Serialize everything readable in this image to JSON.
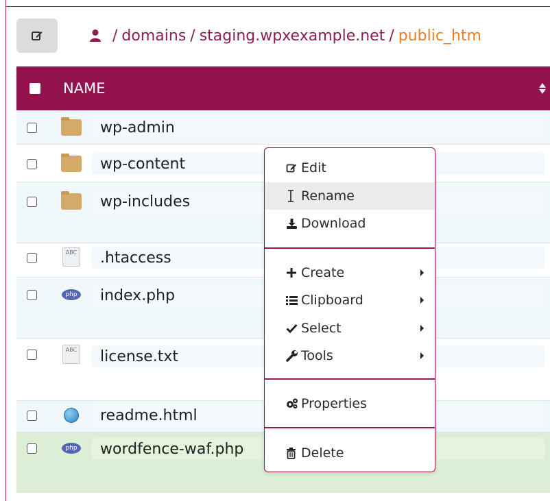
{
  "breadcrumb": {
    "items": [
      "domains",
      "staging.wpxexample.net"
    ],
    "current": "public_htm",
    "separator": "/"
  },
  "table": {
    "header_name": "NAME",
    "rows": [
      {
        "name": "wp-admin",
        "type": "folder"
      },
      {
        "name": "wp-content",
        "type": "folder"
      },
      {
        "name": "wp-includes",
        "type": "folder"
      },
      {
        "name": ".htaccess",
        "type": "text"
      },
      {
        "name": "index.php",
        "type": "php"
      },
      {
        "name": "license.txt",
        "type": "text"
      },
      {
        "name": "readme.html",
        "type": "html"
      },
      {
        "name": "wordfence-waf.php",
        "type": "php",
        "selected": true
      }
    ]
  },
  "icons": {
    "text_label": "ABC",
    "php_label": "php"
  },
  "context_menu": {
    "items": [
      {
        "label": "Edit",
        "icon": "edit-icon"
      },
      {
        "label": "Rename",
        "icon": "text-cursor-icon"
      },
      {
        "label": "Download",
        "icon": "download-icon"
      },
      {
        "label": "Create",
        "icon": "plus-icon",
        "submenu": true
      },
      {
        "label": "Clipboard",
        "icon": "list-icon",
        "submenu": true
      },
      {
        "label": "Select",
        "icon": "check-icon",
        "submenu": true
      },
      {
        "label": "Tools",
        "icon": "wrench-icon",
        "submenu": true
      },
      {
        "label": "Properties",
        "icon": "cogs-icon"
      },
      {
        "label": "Delete",
        "icon": "trash-icon"
      }
    ]
  },
  "colors": {
    "header_bg": "#93124e",
    "accent": "#9b1a55",
    "breadcrumb_current": "#ee7d24",
    "selected_row": "#dcefd6"
  }
}
